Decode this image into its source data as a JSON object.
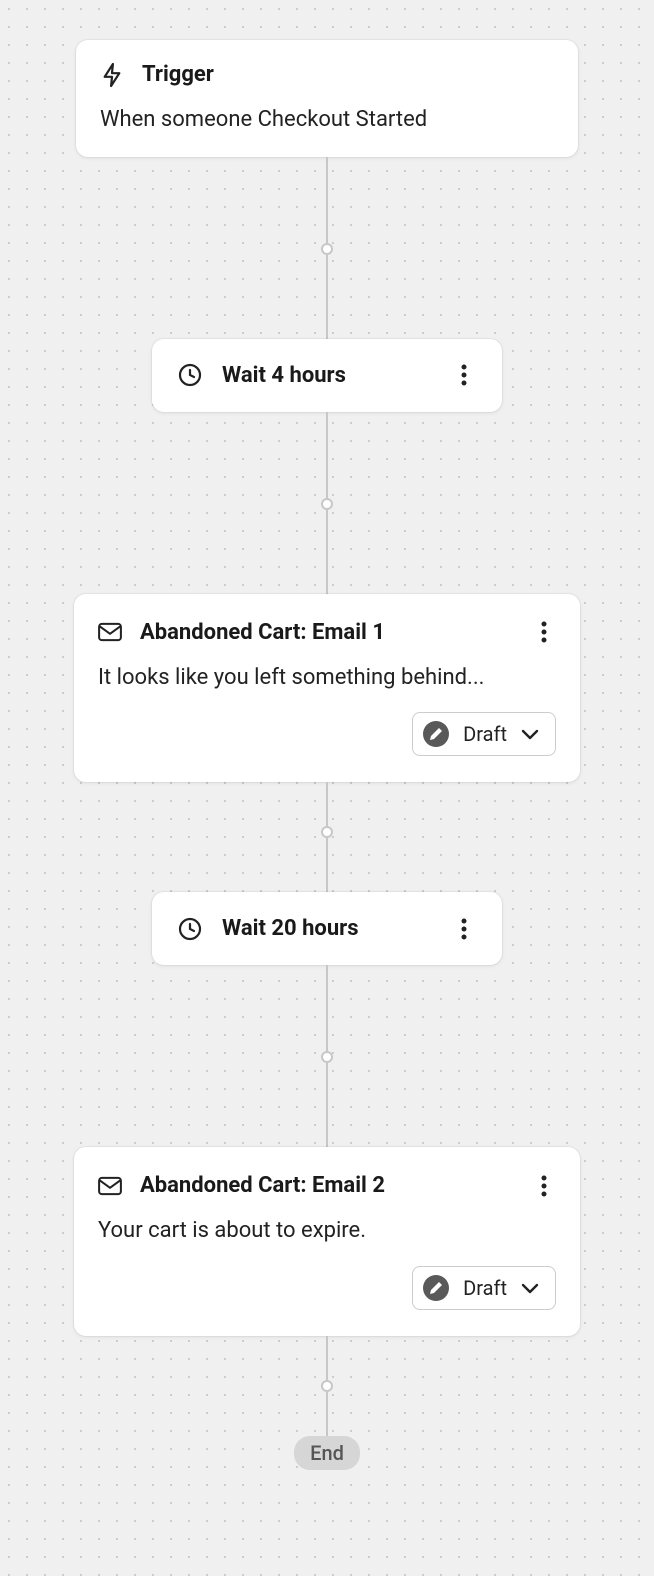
{
  "trigger": {
    "title": "Trigger",
    "description": "When someone Checkout Started"
  },
  "wait1": {
    "label": "Wait 4 hours"
  },
  "email1": {
    "title": "Abandoned Cart: Email 1",
    "description": "It looks like you left something behind...",
    "status": "Draft"
  },
  "wait2": {
    "label": "Wait 20 hours"
  },
  "email2": {
    "title": "Abandoned Cart: Email 2",
    "description": "Your cart is about to expire.",
    "status": "Draft"
  },
  "end": {
    "label": "End"
  }
}
